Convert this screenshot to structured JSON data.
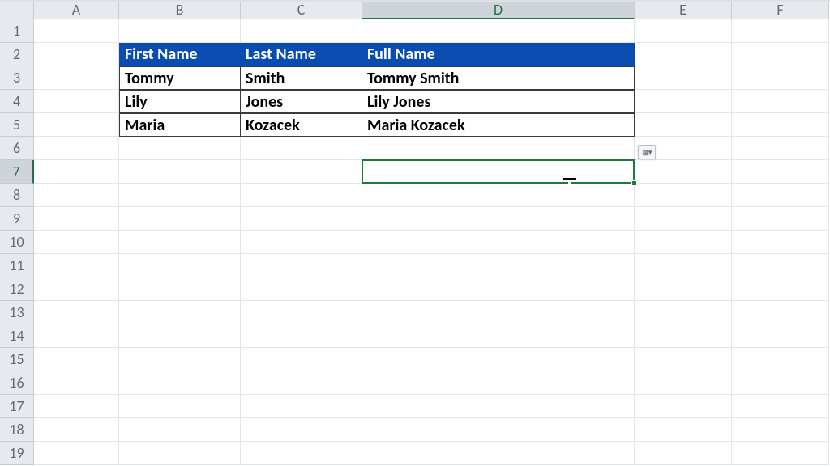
{
  "columns": [
    {
      "letter": "A",
      "width_class": "cA",
      "selected": false
    },
    {
      "letter": "B",
      "width_class": "cB",
      "selected": false
    },
    {
      "letter": "C",
      "width_class": "cC",
      "selected": false
    },
    {
      "letter": "D",
      "width_class": "cD",
      "selected": true
    },
    {
      "letter": "E",
      "width_class": "cE",
      "selected": false
    },
    {
      "letter": "F",
      "width_class": "cF",
      "selected": false
    }
  ],
  "rows": [
    {
      "num": "1",
      "selected": false
    },
    {
      "num": "2",
      "selected": false
    },
    {
      "num": "3",
      "selected": false
    },
    {
      "num": "4",
      "selected": false
    },
    {
      "num": "5",
      "selected": false
    },
    {
      "num": "6",
      "selected": false
    },
    {
      "num": "7",
      "selected": true
    },
    {
      "num": "8",
      "selected": false
    },
    {
      "num": "9",
      "selected": false
    },
    {
      "num": "10",
      "selected": false
    },
    {
      "num": "11",
      "selected": false
    },
    {
      "num": "12",
      "selected": false
    },
    {
      "num": "13",
      "selected": false
    },
    {
      "num": "14",
      "selected": false
    },
    {
      "num": "15",
      "selected": false
    },
    {
      "num": "16",
      "selected": false
    },
    {
      "num": "17",
      "selected": false
    },
    {
      "num": "18",
      "selected": false
    },
    {
      "num": "19",
      "selected": false
    }
  ],
  "table": {
    "headers": {
      "b": "First Name",
      "c": "Last Name",
      "d": "Full Name"
    },
    "data": [
      {
        "first": "Tommy",
        "last": "Smith",
        "full": "Tommy Smith"
      },
      {
        "first": "Lily",
        "last": "Jones",
        "full": "Lily  Jones"
      },
      {
        "first": "Maria",
        "last": "Kozacek",
        "full": "Maria Kozacek"
      }
    ]
  },
  "selection": {
    "cell": "D7"
  },
  "smart_tag": {
    "type": "autofill-options"
  },
  "colors": {
    "header_bg": "#0a4db0",
    "selection": "#1a7a3a"
  }
}
